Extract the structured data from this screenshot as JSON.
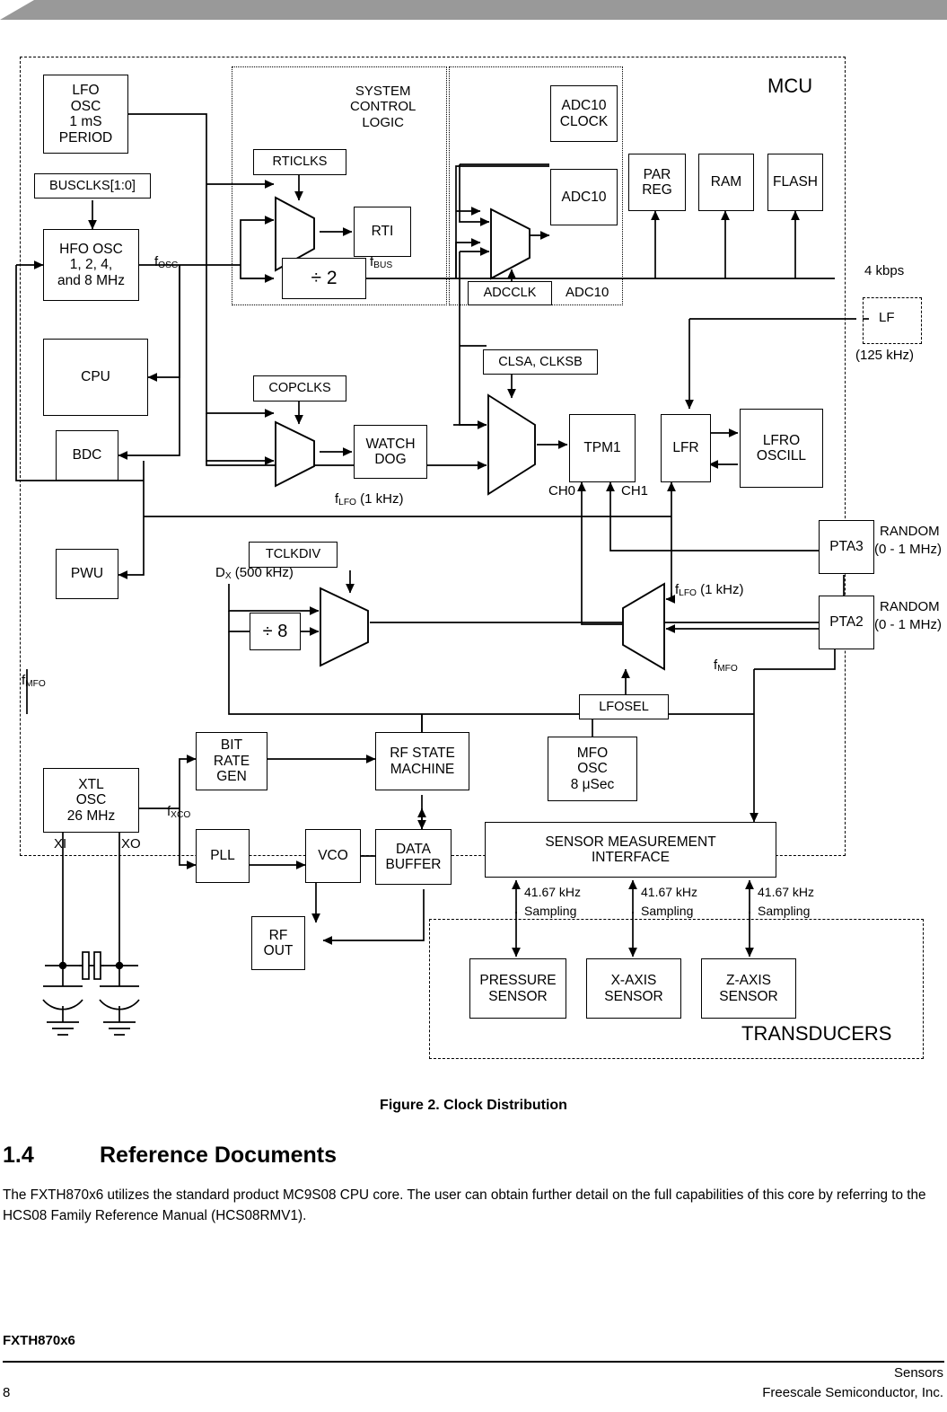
{
  "figure": {
    "caption": "Figure 2.  Clock Distribution",
    "regions": {
      "mcu": "MCU",
      "system_control_logic": "SYSTEM\nCONTROL\nLOGIC",
      "adc10_group": "ADC10",
      "transducers": "TRANSDUCERS"
    },
    "blocks": {
      "lfo_osc": "LFO\nOSC\n1 mS\nPERIOD",
      "busclks": "BUSCLKS[1:0]",
      "hfo_osc": "HFO OSC\n1, 2, 4,\nand 8 MHz",
      "cpu": "CPU",
      "bdc": "BDC",
      "pwu": "PWU",
      "rticlks": "RTICLKS",
      "rti": "RTI",
      "div2": "÷ 2",
      "copclks": "COPCLKS",
      "watchdog": "WATCH\nDOG",
      "tclkdiv": "TCLKDIV",
      "div8": "÷ 8",
      "adc10_clock": "ADC10\nCLOCK",
      "adc10": "ADC10",
      "adcclk": "ADCCLK",
      "par_reg": "PAR\nREG",
      "ram": "RAM",
      "flash": "FLASH",
      "lf": "LF",
      "clsa_clksb": "CLSA, CLKSB",
      "tpm1": "TPM1",
      "lfr": "LFR",
      "lfro_oscill": "LFRO\nOSCILL",
      "pta3": "PTA3",
      "pta2": "PTA2",
      "lfosel": "LFOSEL",
      "xtl_osc": "XTL\nOSC\n26 MHz",
      "bit_rate_gen": "BIT\nRATE\nGEN",
      "rf_state_machine": "RF STATE\nMACHINE",
      "mfo_osc": "MFO\nOSC\n8 μSec",
      "pll": "PLL",
      "vco": "VCO",
      "data_buffer": "DATA\nBUFFER",
      "rf_out": "RF\nOUT",
      "sensor_measurement_interface": "SENSOR MEASUREMENT\nINTERFACE",
      "pressure_sensor": "PRESSURE\nSENSOR",
      "x_axis_sensor": "X-AXIS\nSENSOR",
      "z_axis_sensor": "Z-AXIS\nSENSOR"
    },
    "signal_labels": {
      "f_osc": "OSC",
      "f_bus": "BUS",
      "f_lfo_wd": "LFO",
      "f_lfo_wd_val": " (1 kHz)",
      "f_lfo_mux": "LFO",
      "f_lfo_mux_val": " (1 kHz)",
      "f_mfo_left": "MFO",
      "f_mfo_right": "MFO",
      "f_xco": "XCO",
      "dx": "D",
      "dx_sub": "X",
      "dx_val": " (500 kHz)",
      "ch0": "CH0",
      "ch1": "CH1",
      "kbps": "4 kbps",
      "lf_freq": "(125 kHz)",
      "random_pta3_l1": "RANDOM",
      "random_pta3_l2": "(0 - 1 MHz)",
      "random_pta2_l1": "RANDOM",
      "random_pta2_l2": "(0 - 1 MHz)",
      "xi": "XI",
      "xo": "XO",
      "sampling1_l1": "41.67 kHz",
      "sampling1_l2": "Sampling",
      "sampling2_l1": "41.67 kHz",
      "sampling2_l2": "Sampling",
      "sampling3_l1": "41.67 kHz",
      "sampling3_l2": "Sampling",
      "adc10_inline": "ADC10"
    }
  },
  "section": {
    "number": "1.4",
    "title": "Reference Documents",
    "paragraph": "The FXTH870x6 utilizes the standard product MC9S08 CPU core. The user can obtain further detail on the full capabilities of this core by referring to the HCS08 Family Reference Manual (HCS08RMV1)."
  },
  "footer": {
    "doc": "FXTH870x6",
    "page": "8",
    "right_line1": "Sensors",
    "right_line2": "Freescale Semiconductor, Inc."
  }
}
